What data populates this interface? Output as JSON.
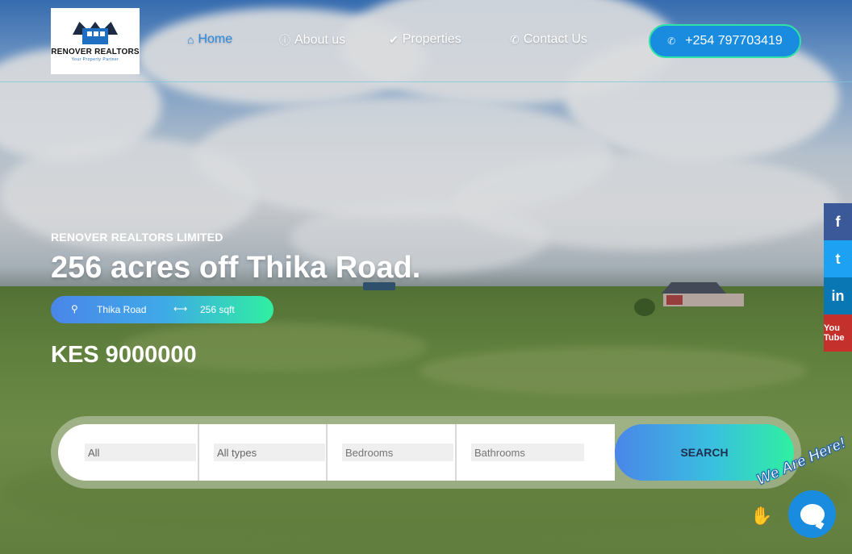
{
  "brand": {
    "logo_name": "RENOVER REALTORS",
    "logo_tagline": "Your Property Partner"
  },
  "nav": {
    "items": [
      {
        "label": "Home",
        "icon": "home-icon",
        "active": true
      },
      {
        "label": "About us",
        "icon": "info-icon",
        "active": false
      },
      {
        "label": "Properties",
        "icon": "check-icon",
        "active": false
      },
      {
        "label": "Contact Us",
        "icon": "phone-icon",
        "active": false
      }
    ],
    "phone": "+254 797703419"
  },
  "hero": {
    "company": "RENOVER REALTORS LIMITED",
    "title": "256 acres off Thika Road.",
    "location": "Thika Road",
    "size": "256 sqft",
    "price": "KES 9000000"
  },
  "search": {
    "location_value": "All",
    "type_value": "All types",
    "bedrooms_placeholder": "Bedrooms",
    "bathrooms_placeholder": "Bathrooms",
    "button_label": "SEARCH"
  },
  "social": {
    "facebook": "f",
    "twitter": "t",
    "linkedin": "in",
    "youtube": "You Tube"
  },
  "chat": {
    "label": "We Are Here!"
  },
  "colors": {
    "accent": "#1a8ce0",
    "accent_green": "#2ff0a0",
    "facebook": "#3b5998",
    "twitter": "#1da1f2",
    "linkedin": "#0a77b5",
    "youtube": "#c4302b"
  }
}
